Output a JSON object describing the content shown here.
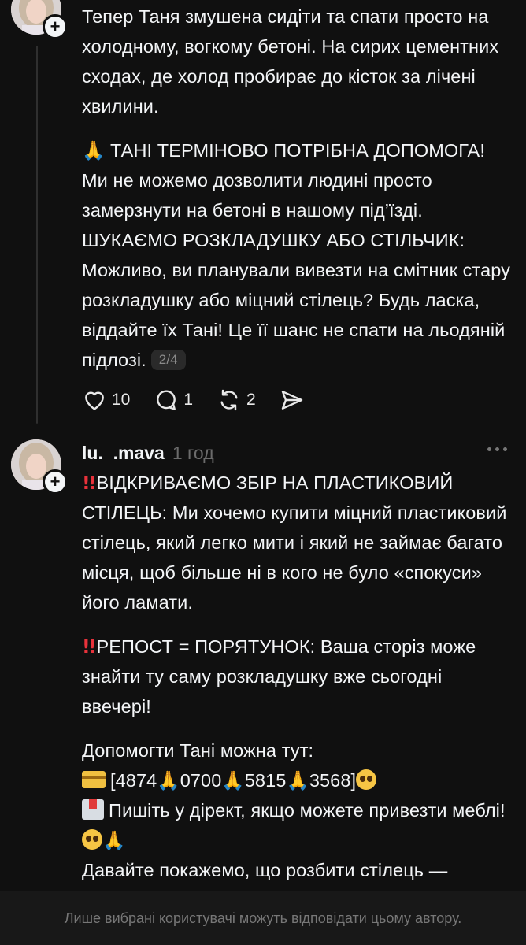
{
  "post1": {
    "paragraphs": [
      "Тепер Таня змушена сидіти та спати просто на холодному, вогкому бетоні. На сирих цементних сходах, де холод пробирає до кісток за лічені хвилини.",
      "🙏 ТАНІ ТЕРМІНОВО ПОТРІБНА ДОПОМОГА! Ми не можемо дозволити людині просто замерзнути на бетоні в нашому під’їзді. ШУКАЄМО РОЗКЛАДУШКУ АБО СТІЛЬЧИК: Можливо, ви планували вивезти на смітник стару розкладушку або міцний стілець? Будь ласка, віддайте їх Тані! Це її шанс не спати на льодяній підлозі."
    ],
    "page_indicator": "2/4",
    "actions": {
      "likes": "10",
      "replies": "1",
      "reposts": "2"
    },
    "icons": {
      "like": "heart-icon",
      "reply": "comment-icon",
      "repost": "repost-icon",
      "share": "send-icon",
      "follow": "plus-icon"
    }
  },
  "post2": {
    "username": "lu._.mava",
    "time": "1 год",
    "p1_text": "ВІДКРИВАЄМО ЗБІР НА ПЛАСТИКОВИЙ СТІЛЕЦЬ: Ми хочемо купити міцний пластиковий стілець, який легко мити і який не займає багато місця, щоб більше ні в кого не було «спокуси» його ламати.",
    "p2_text": "РЕПОСТ = ПОРЯТУНОК: Ваша сторіз може знайти ту саму розкладушку вже сьогодні ввечері!",
    "help_title": "Допомогти Тані можна тут:",
    "card_open": "[4874",
    "card_g1": "0700",
    "card_g2": "5815",
    "card_close": "3568]",
    "direct_text": "Пишіть у дірект, якщо можете привезти меблі!",
    "last_line": "Давайте покажемо, що розбити стілець —",
    "icons": {
      "double_exclamation": "double-exclamation-icon",
      "pray": "pray-icon",
      "credit_card": "credit-card-icon",
      "inbox": "inbox-tray-icon",
      "pleading_face": "pleading-face-icon",
      "more": "more-options-icon"
    }
  },
  "footer": {
    "text": "Лише вибрані користувачі можуть відповідати цьому автору."
  },
  "colors": {
    "background": "#101010",
    "text": "#f3f5f7",
    "muted": "#6b6b6b",
    "emoji_red": "#e8323b"
  }
}
